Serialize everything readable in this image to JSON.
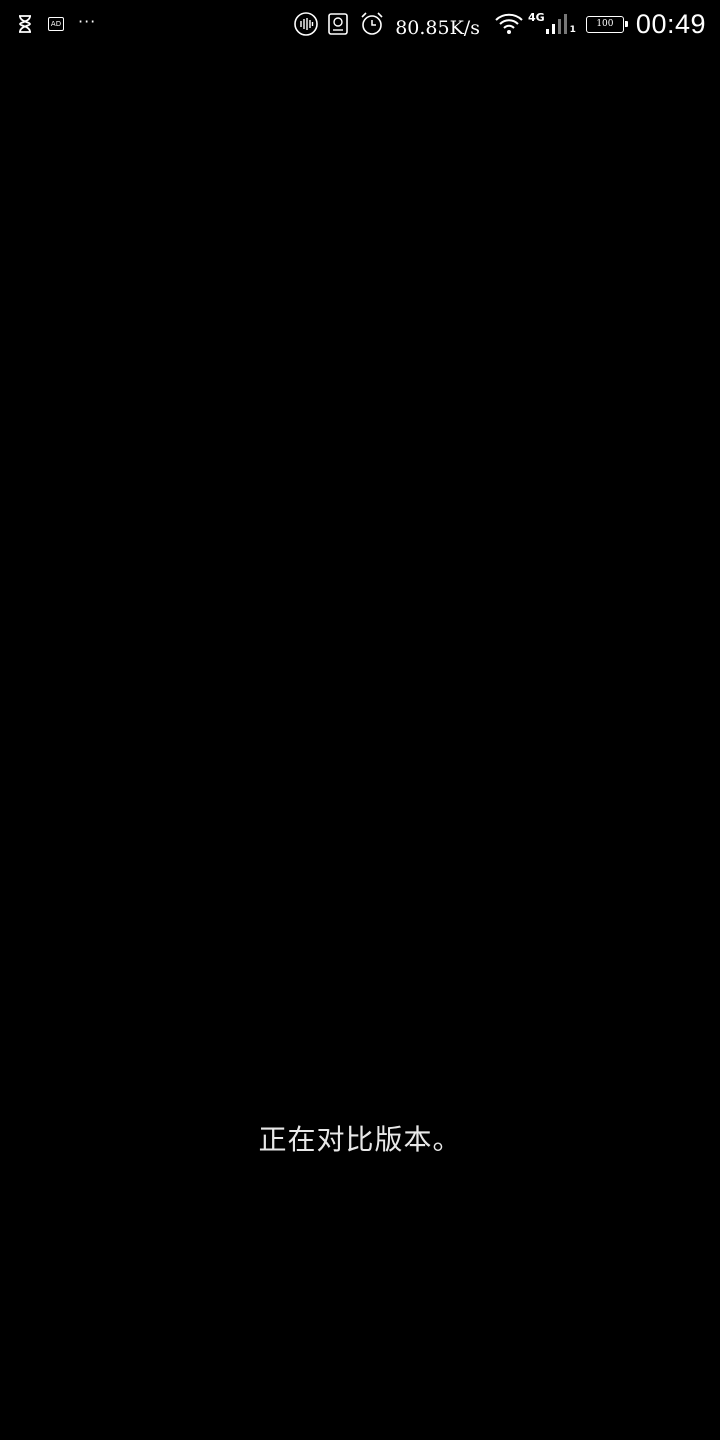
{
  "status_bar": {
    "left_icons": [
      "hourglass-icon",
      "ad-icon",
      "more-dots-icon"
    ],
    "ad_label": "AD",
    "dots": "···",
    "right_icons": [
      "sound-wave-icon",
      "sim-manager-icon",
      "alarm-clock-icon",
      "wifi-icon",
      "signal-icon"
    ],
    "net_speed": "80.85K/s",
    "net_type": "4G",
    "sim_slot": "1",
    "battery_level": "100",
    "time": "00:49"
  },
  "main": {
    "message": "正在对比版本。"
  },
  "colors": {
    "background": "#000000",
    "text": "#ffffff",
    "message_text": "#e8e8e8"
  }
}
